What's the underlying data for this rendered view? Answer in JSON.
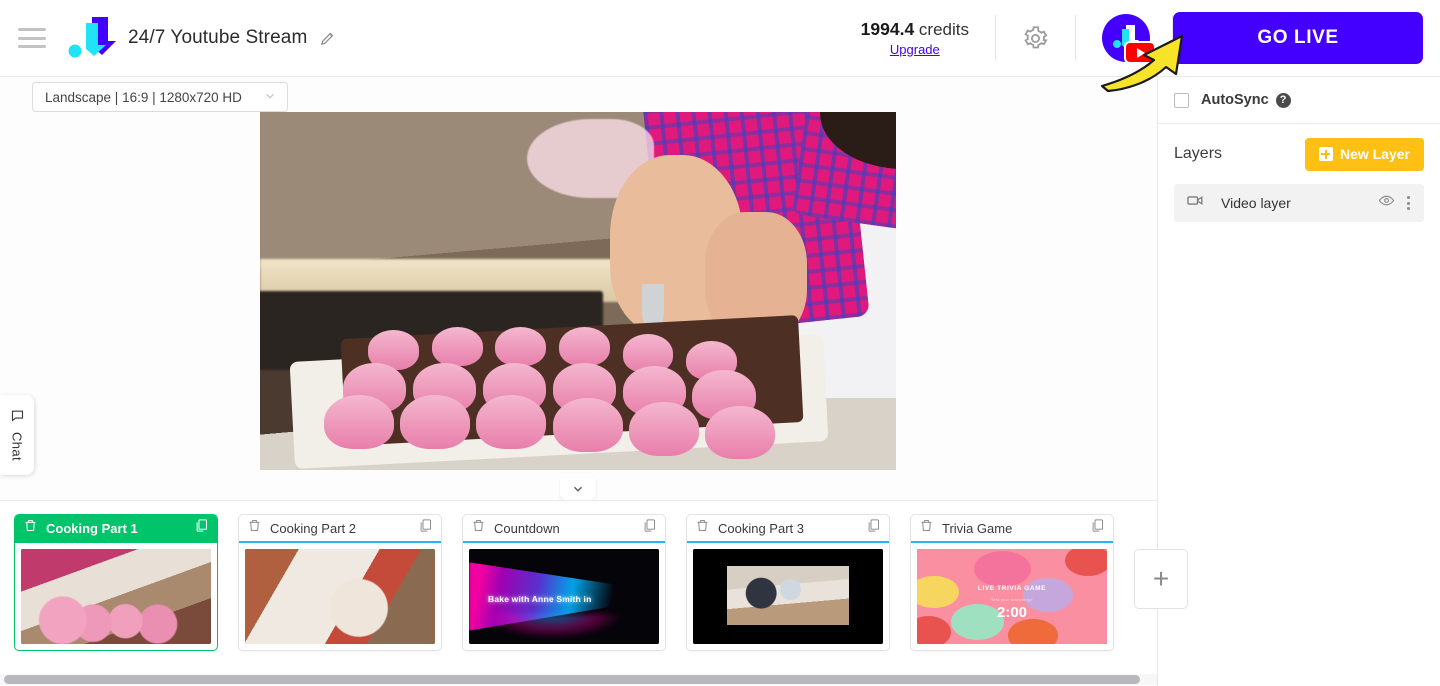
{
  "header": {
    "menu_icon": "hamburger-icon",
    "logo_icon": "app-logo-icon",
    "title": "24/7 Youtube Stream",
    "edit_icon": "pencil-icon",
    "credits_value": "1994.4",
    "credits_label": "credits",
    "upgrade_label": "Upgrade",
    "settings_icon": "gear-icon",
    "avatar_icon": "user-avatar",
    "avatar_badge_icon": "youtube-icon",
    "go_live_label": "GO LIVE",
    "annotation_icon": "yellow-arrow-annotation"
  },
  "stage": {
    "ratio_select_value": "Landscape | 16:9 | 1280x720 HD",
    "ratio_chevron_icon": "chevron-down-icon",
    "collapse_icon": "chevron-down-icon",
    "preview_alt": "video-preview"
  },
  "chat_tab": {
    "label": "Chat",
    "icon": "chat-bubble-icon"
  },
  "right_panel": {
    "autosync_label": "AutoSync",
    "autosync_checked": false,
    "help_icon": "question-mark-icon",
    "layers_title": "Layers",
    "new_layer_label": "New Layer",
    "new_layer_icon": "plus-square-icon",
    "layers": [
      {
        "name": "Video layer",
        "type_icon": "video-camera-icon",
        "visibility_icon": "eye-icon",
        "menu_icon": "kebab-menu-icon"
      }
    ]
  },
  "scenes": {
    "add_scene_label": "+",
    "delete_icon": "trash-icon",
    "duplicate_icon": "copy-icon",
    "items": [
      {
        "title": "Cooking Part 1",
        "active": true,
        "art": "art-cook1",
        "overlay_text": ""
      },
      {
        "title": "Cooking Part 2",
        "active": false,
        "art": "art-cook2",
        "overlay_text": ""
      },
      {
        "title": "Countdown",
        "active": false,
        "art": "art-count",
        "overlay_text": "Bake with Anne Smith in"
      },
      {
        "title": "Cooking Part 3",
        "active": false,
        "art": "art-cook3",
        "overlay_text": ""
      },
      {
        "title": "Trivia Game",
        "active": false,
        "art": "art-trivia",
        "overlay_text": "LIVE TRIVIA GAME",
        "overlay_sub": "Test your knowledge",
        "overlay_time": "2:00"
      }
    ]
  },
  "colors": {
    "brand_purple": "#4400FF",
    "accent_cyan": "#22E3F5",
    "active_green": "#00C46A",
    "new_layer_amber": "#FFC014",
    "scene_underline_blue": "#29B6F6",
    "youtube_red": "#FF0000",
    "annotation_yellow": "#F7E32A"
  }
}
